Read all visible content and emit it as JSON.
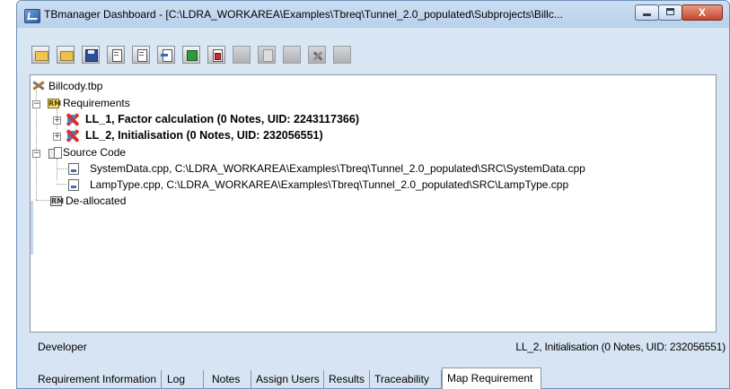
{
  "window": {
    "title": "TBmanager Dashboard - [C:\\LDRA_WORKAREA\\Examples\\Tbreq\\Tunnel_2.0_populated\\Subprojects\\Billc...",
    "controls": {
      "minimize": "minimize",
      "maximize": "maximize",
      "close": "X"
    }
  },
  "toolbar": {
    "buttons": [
      {
        "icon": "open-folder-icon",
        "enabled": true
      },
      {
        "icon": "folder-icon",
        "enabled": true
      },
      {
        "icon": "save-icon",
        "enabled": true
      },
      {
        "icon": "document-icon",
        "enabled": true
      },
      {
        "icon": "document-icon",
        "enabled": true
      },
      {
        "icon": "import-icon",
        "enabled": true
      },
      {
        "icon": "green-grid-icon",
        "enabled": true
      },
      {
        "icon": "red-document-icon",
        "enabled": true
      },
      {
        "icon": "disabled-icon",
        "enabled": false
      },
      {
        "icon": "disabled-icon",
        "enabled": false
      },
      {
        "icon": "disabled-icon",
        "enabled": false
      },
      {
        "icon": "tools-icon",
        "enabled": false
      },
      {
        "icon": "disabled-icon",
        "enabled": false
      }
    ]
  },
  "tree": {
    "root": "Billcody.tbp",
    "requirements": {
      "label": "Requirements",
      "icon_text": "RM",
      "items": [
        "LL_1, Factor calculation (0 Notes, UID: 2243117366)",
        "LL_2, Initialisation (0 Notes, UID: 232056551)"
      ]
    },
    "source_code": {
      "label": "Source Code",
      "files": [
        "SystemData.cpp, C:\\LDRA_WORKAREA\\Examples\\Tbreq\\Tunnel_2.0_populated\\SRC\\SystemData.cpp",
        "LampType.cpp, C:\\LDRA_WORKAREA\\Examples\\Tbreq\\Tunnel_2.0_populated\\SRC\\LampType.cpp"
      ]
    },
    "deallocated": {
      "label": "De-allocated",
      "icon_text": "RM"
    }
  },
  "status": {
    "left": "Developer",
    "right": "LL_2, Initialisation (0 Notes, UID: 232056551)"
  },
  "tabs": [
    {
      "label": "Requirement Information",
      "active": false
    },
    {
      "label": "Log",
      "active": false
    },
    {
      "label": "Notes",
      "active": false
    },
    {
      "label": "Assign Users",
      "active": false
    },
    {
      "label": "Results",
      "active": false
    },
    {
      "label": "Traceability",
      "active": false
    },
    {
      "label": "Map Requirement",
      "active": true
    }
  ]
}
